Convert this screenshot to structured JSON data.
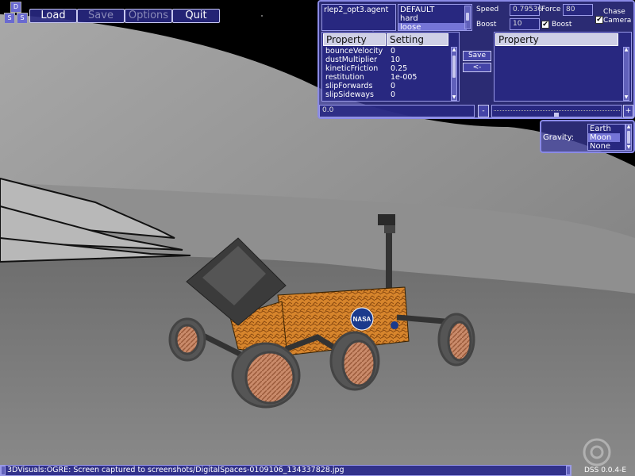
{
  "toolbar": {
    "logo_letters": [
      "D",
      "S",
      "S"
    ],
    "load": "Load",
    "save": "Save",
    "options": "Options",
    "quit": "Quit"
  },
  "agent_panel": {
    "agent_file": "rlep2_opt3.agent",
    "presets": [
      "DEFAULT",
      "hard",
      "loose"
    ],
    "selected_preset": "loose",
    "speed_label": "Speed",
    "speed_value": "0.79536",
    "force_label": "Force",
    "force_value": "80",
    "boost_label": "Boost",
    "boost_value": "10",
    "boost_check_label": "Boost",
    "boost_checked": true,
    "chase_label_1": "Chase",
    "chase_label_2": "Camera",
    "chase_checked": true,
    "table_headers": [
      "Property",
      "Setting"
    ],
    "properties": [
      {
        "name": "bounceVelocity",
        "value": "0"
      },
      {
        "name": "dustMultiplier",
        "value": "10"
      },
      {
        "name": "kineticFriction",
        "value": "0.25"
      },
      {
        "name": "restitution",
        "value": "1e-005"
      },
      {
        "name": "slipForwards",
        "value": "0"
      },
      {
        "name": "slipSideways",
        "value": "0"
      }
    ],
    "save_button": "Save",
    "back_button": "<-",
    "right_header": "Property",
    "value_field": "0.0",
    "minus_button": "-",
    "plus_button": "+"
  },
  "gravity_panel": {
    "label": "Gravity:",
    "options": [
      "Earth",
      "Moon",
      "None"
    ],
    "selected": "Moon"
  },
  "status": {
    "message": "3DVisuals:OGRE: Screen captured to screenshots/DigitalSpaces-0109106_134337828.jpg",
    "version": "DSS 0.0.4-E"
  }
}
